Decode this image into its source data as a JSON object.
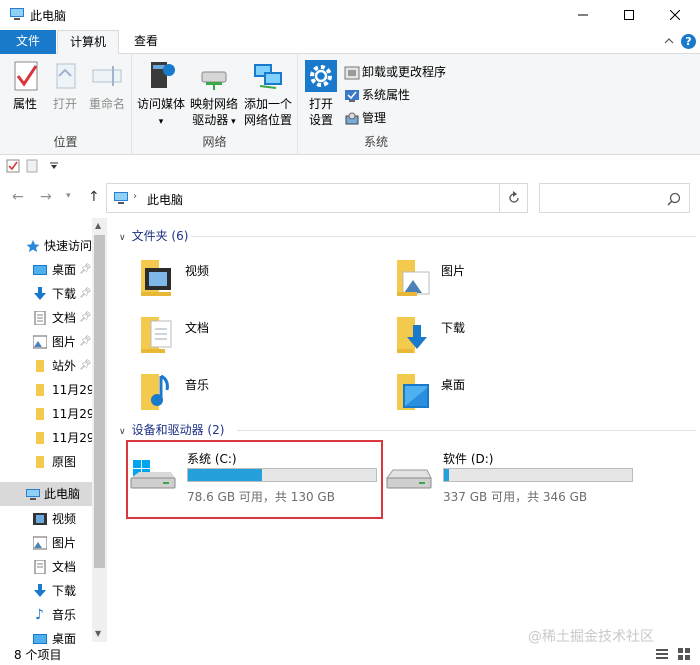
{
  "window": {
    "title": "此电脑"
  },
  "ribbon_tabs": {
    "file": "文件",
    "computer": "计算机",
    "view": "查看"
  },
  "ribbon": {
    "location": {
      "label": "位置",
      "properties": "属性",
      "open": "打开",
      "rename": "重命名"
    },
    "network": {
      "label": "网络",
      "access_media": "访问媒体",
      "map_drive_line1": "映射网络",
      "map_drive_line2": "驱动器",
      "add_location_line1": "添加一个",
      "add_location_line2": "网络位置"
    },
    "system": {
      "label": "系统",
      "open_settings_line1": "打开",
      "open_settings_line2": "设置",
      "uninstall": "卸载或更改程序",
      "system_properties": "系统属性",
      "manage": "管理"
    }
  },
  "address": {
    "path": "此电脑"
  },
  "nav": {
    "quick_access": "快速访问",
    "items": [
      {
        "label": "桌面",
        "pinned": true
      },
      {
        "label": "下载",
        "pinned": true
      },
      {
        "label": "文档",
        "pinned": true
      },
      {
        "label": "图片",
        "pinned": true
      },
      {
        "label": "站外",
        "pinned": true
      },
      {
        "label": "11月29"
      },
      {
        "label": "11月29"
      },
      {
        "label": "11月29"
      },
      {
        "label": "原图"
      }
    ],
    "this_pc": "此电脑",
    "pc_items": [
      {
        "label": "视频"
      },
      {
        "label": "图片"
      },
      {
        "label": "文档"
      },
      {
        "label": "下载"
      },
      {
        "label": "音乐"
      },
      {
        "label": "桌面"
      }
    ]
  },
  "folders_section": {
    "title": "文件夹 (6)"
  },
  "folders": [
    {
      "name": "视频"
    },
    {
      "name": "图片"
    },
    {
      "name": "文档"
    },
    {
      "name": "下载"
    },
    {
      "name": "音乐"
    },
    {
      "name": "桌面"
    }
  ],
  "drives_section": {
    "title": "设备和驱动器 (2)"
  },
  "drives": [
    {
      "name": "系统 (C:)",
      "free": "78.6 GB 可用，共 130 GB",
      "used_fraction": 0.395
    },
    {
      "name": "软件 (D:)",
      "free": "337 GB 可用，共 346 GB",
      "used_fraction": 0.026
    }
  ],
  "status": {
    "count": "8 个项目"
  },
  "watermark": "@稀土掘金技术社区",
  "colors": {
    "accent": "#1979ca",
    "drive_fill": "#26a0da",
    "highlight": "#d9363e"
  }
}
